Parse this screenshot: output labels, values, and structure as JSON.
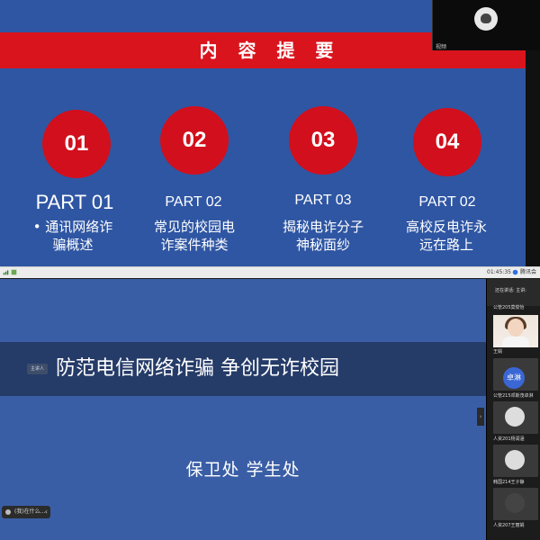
{
  "top_slide": {
    "title": "内 容 提 要",
    "parts": [
      {
        "number": "01",
        "label": "PART 01",
        "desc_line1": "• 通讯网络诈",
        "desc_line2": "骗概述"
      },
      {
        "number": "02",
        "label": "PART 02",
        "desc_line1": "常见的校园电",
        "desc_line2": "诈案件种类"
      },
      {
        "number": "03",
        "label": "PART 03",
        "desc_line1": "揭秘电诈分子",
        "desc_line2": "神秘面纱"
      },
      {
        "number": "04",
        "label": "PART 02",
        "desc_line1": "高校反电诈永",
        "desc_line2": "远在路上"
      }
    ],
    "colors": {
      "background": "#2f56a3",
      "accent": "#d9141d"
    }
  },
  "video_tile": {
    "name": "视频"
  },
  "taskbar": {
    "time": "01:45:35",
    "app": "腾讯会议"
  },
  "bottom_slide": {
    "chip": "主讲人",
    "banner": "防范电信网络诈骗 争创无诈校园",
    "subtitle": "保卫处   学生处",
    "pill_text": "(我)在什么..."
  },
  "panel": {
    "header": "还在讲话: 主讲:",
    "participants": [
      {
        "label": "公管205莫俊怡",
        "kind": "avatar"
      },
      {
        "label": "王娟",
        "kind": "photo"
      },
      {
        "label": "公管215邓斯茂卓淋",
        "kind": "initials",
        "initials": "卓淋"
      },
      {
        "label": "人资201杨润涵",
        "kind": "avatar"
      },
      {
        "label": "韩国214王子静",
        "kind": "avatar"
      },
      {
        "label": "人资207王丽娟",
        "kind": "avatar-dark"
      }
    ]
  }
}
